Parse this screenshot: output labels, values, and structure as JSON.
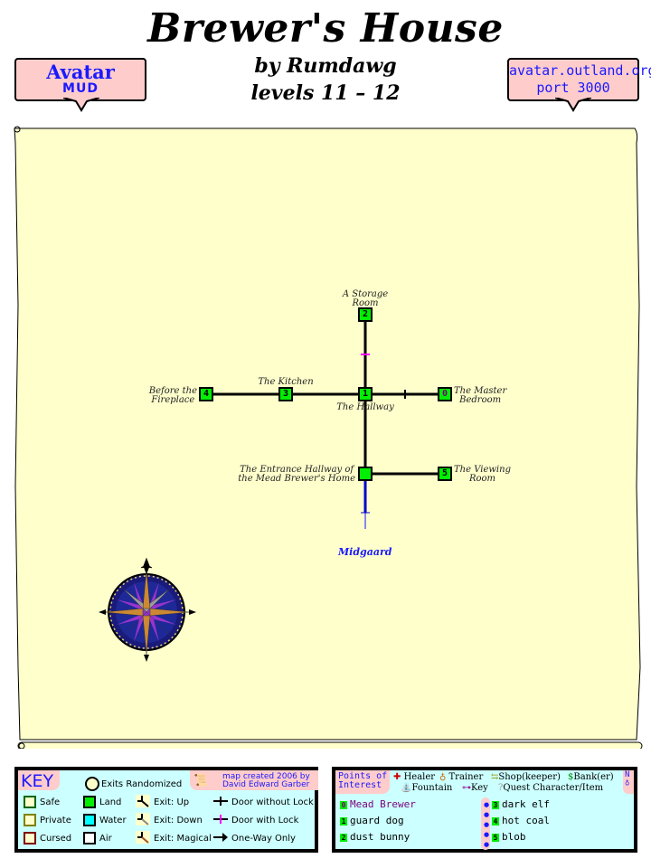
{
  "header": {
    "title": "Brewer's House",
    "byline": "by Rumdawg",
    "levels": "levels 11 – 12"
  },
  "banners": {
    "left": {
      "line1": "Avatar",
      "line2": "MUD"
    },
    "right": {
      "line1": "avatar.outland.org",
      "line2": "port 3000"
    }
  },
  "map": {
    "rooms": [
      {
        "id": "0",
        "label_lines": [
          "The Master",
          "Bedroom"
        ],
        "color": "#00ee00",
        "number_color": "#7a007a"
      },
      {
        "id": "1",
        "label_lines": [
          "The Hallway"
        ],
        "color": "#00ee00"
      },
      {
        "id": "2",
        "label_lines": [
          "A Storage",
          "Room"
        ],
        "color": "#00ee00"
      },
      {
        "id": "3",
        "label_lines": [
          "The Kitchen"
        ],
        "color": "#00ee00"
      },
      {
        "id": "4",
        "label_lines": [
          "Before the",
          "Fireplace"
        ],
        "color": "#00ee00"
      },
      {
        "id": "5",
        "label_lines": [
          "The Viewing",
          "Room"
        ],
        "color": "#00ee00"
      },
      {
        "id": "",
        "label_lines": [
          "The Entrance Hallway of",
          "the Mead Brewer's Home"
        ],
        "color": "#00ee00"
      }
    ],
    "exit_label": "Midgaard",
    "compass": "compass-rose"
  },
  "key": {
    "title": "KEY",
    "exits_randomized": "Exits Randomized",
    "credit_line1": "map created 2006 by",
    "credit_line2": "David Edward Garber",
    "zones": [
      {
        "label": "Safe",
        "border": "#006600"
      },
      {
        "label": "Private",
        "border": "#808000"
      },
      {
        "label": "Cursed",
        "border": "#800000"
      }
    ],
    "terrain": [
      {
        "label": "Land",
        "fill": "#00ee00"
      },
      {
        "label": "Water",
        "fill": "#00ffff"
      },
      {
        "label": "Air",
        "fill": "#ffffff"
      }
    ],
    "exits": [
      {
        "label": "Exit: Up"
      },
      {
        "label": "Exit: Down"
      },
      {
        "label": "Exit: Magical"
      }
    ],
    "doors": [
      {
        "label": "Door without Lock"
      },
      {
        "label": "Door with Lock"
      },
      {
        "label": "One-Way Only"
      }
    ]
  },
  "poi": {
    "title_line1": "Points of",
    "title_line2": "Interest",
    "types_row1": [
      "Healer",
      "Trainer",
      "Shop(keeper)",
      "Bank(er)"
    ],
    "types_row2": [
      "Fountain",
      "Key",
      "Quest Character/Item"
    ],
    "north": "N",
    "items": [
      {
        "num": "0",
        "name": "Mead Brewer",
        "color": "#7a007a"
      },
      {
        "num": "1",
        "name": "guard dog",
        "color": "#000000"
      },
      {
        "num": "2",
        "name": "dust bunny",
        "color": "#000000"
      },
      {
        "num": "3",
        "name": "dark elf",
        "color": "#000000"
      },
      {
        "num": "4",
        "name": "hot coal",
        "color": "#000000"
      },
      {
        "num": "5",
        "name": "blob",
        "color": "#000000"
      }
    ]
  }
}
